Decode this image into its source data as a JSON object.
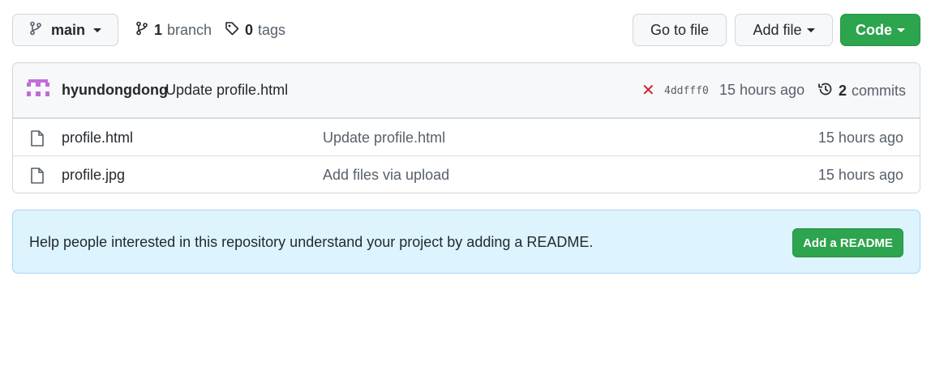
{
  "toolbar": {
    "branch_name": "main",
    "branch_count": "1",
    "branch_label": "branch",
    "tag_count": "0",
    "tag_label": "tags",
    "go_to_file": "Go to file",
    "add_file": "Add file",
    "code": "Code"
  },
  "commit": {
    "author": "hyundongdong",
    "message": "Update profile.html",
    "status": "failed",
    "sha": "4ddfff0",
    "time": "15 hours ago",
    "commit_count": "2",
    "commit_label": "commits"
  },
  "files": [
    {
      "name": "profile.html",
      "message": "Update profile.html",
      "time": "15 hours ago"
    },
    {
      "name": "profile.jpg",
      "message": "Add files via upload",
      "time": "15 hours ago"
    }
  ],
  "readme": {
    "text": "Help people interested in this repository understand your project by adding a README.",
    "button": "Add a README"
  },
  "colors": {
    "primary_green": "#2da44e",
    "fail_red": "#cf222e",
    "banner_bg": "#ddf4ff",
    "avatar_purple": "#c36bd8"
  }
}
